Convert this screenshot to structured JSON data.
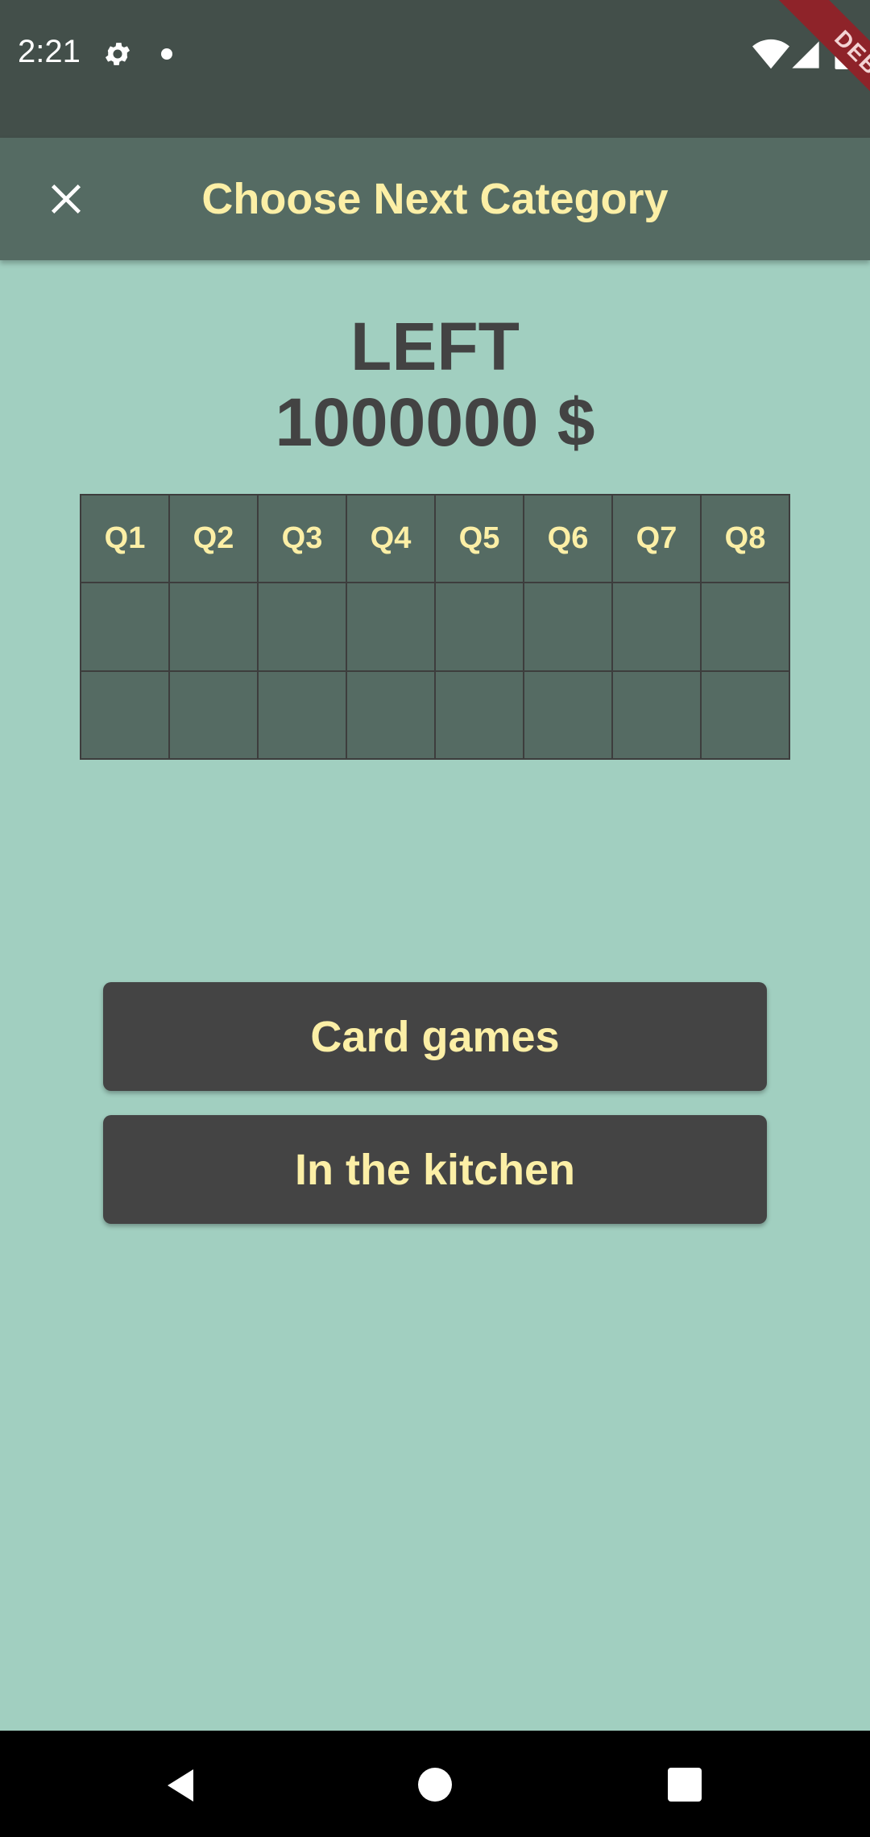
{
  "status_bar": {
    "time": "2:21",
    "icons": [
      "gear-icon",
      "notification-dot-icon",
      "wifi-icon",
      "signal-icon",
      "battery-icon"
    ],
    "debug_banner": "DEBUG"
  },
  "app_bar": {
    "close_icon": "close-icon",
    "title": "Choose Next Category"
  },
  "heading": {
    "line1": "LEFT",
    "line2": "1000000 $"
  },
  "question_grid": {
    "headers": [
      "Q1",
      "Q2",
      "Q3",
      "Q4",
      "Q5",
      "Q6",
      "Q7",
      "Q8"
    ],
    "rows": [
      [
        "",
        "",
        "",
        "",
        "",
        "",
        "",
        ""
      ],
      [
        "",
        "",
        "",
        "",
        "",
        "",
        "",
        ""
      ]
    ]
  },
  "categories": [
    {
      "label": "Card games"
    },
    {
      "label": "In the kitchen"
    }
  ],
  "nav_bar": {
    "icons": [
      "back-icon",
      "home-icon",
      "recents-icon"
    ]
  },
  "colors": {
    "background": "#a1cfc0",
    "status_bar": "#434f4a",
    "app_bar": "#556b63",
    "accent_text": "#fcefa6",
    "button": "#444444",
    "heading_text": "#434343",
    "debug_ribbon": "#8e2329"
  }
}
